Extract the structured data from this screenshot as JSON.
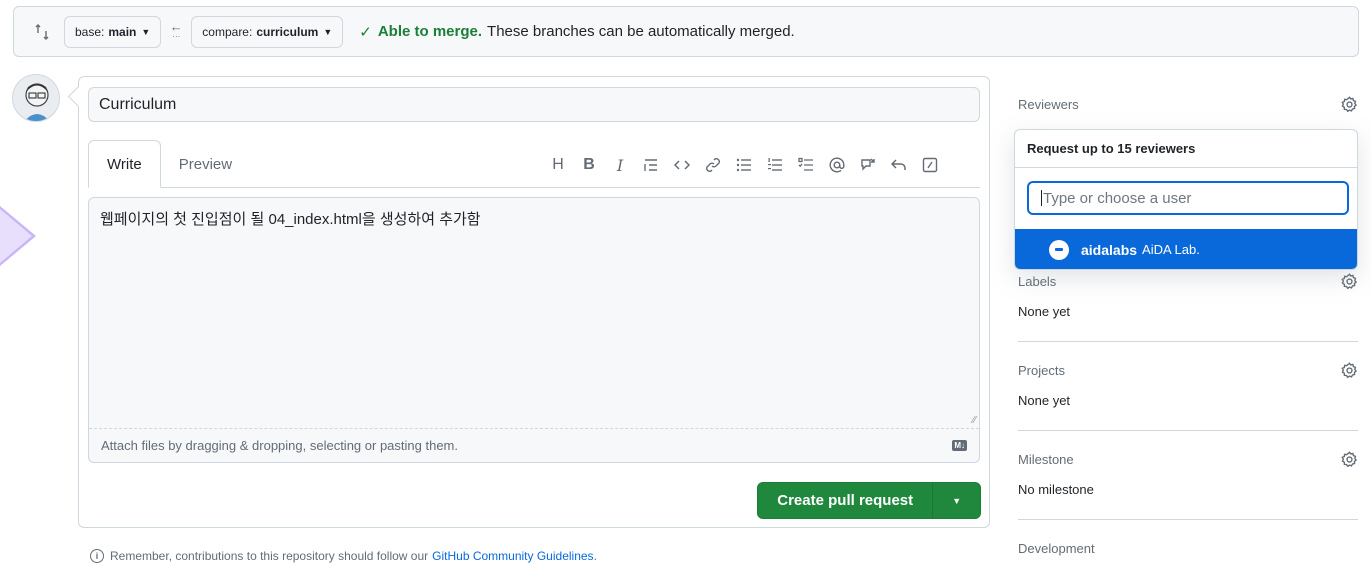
{
  "compare": {
    "base_label": "base:",
    "base_branch": "main",
    "compare_label": "compare:",
    "compare_branch": "curriculum",
    "merge_ok": "Able to merge.",
    "merge_text": "These branches can be automatically merged."
  },
  "form": {
    "title_value": "Curriculum",
    "tabs": [
      {
        "label": "Write",
        "active": true
      },
      {
        "label": "Preview",
        "active": false
      }
    ],
    "toolbar": [
      "heading-icon",
      "bold-icon",
      "italic-icon",
      "quote-icon",
      "code-icon",
      "link-icon",
      "unordered-list-icon",
      "ordered-list-icon",
      "task-list-icon",
      "mention-icon",
      "reference-icon",
      "undo-icon",
      "slash-command-icon"
    ],
    "body_text": "웹페이지의 첫 진입점이 될 04_index.html을 생성하여 추가함",
    "attach_hint": "Attach files by dragging & dropping, selecting or pasting them.",
    "markdown_badge": "M↓",
    "create_label": "Create pull request"
  },
  "footer": {
    "remember_text": "Remember, contributions to this repository should follow our",
    "guidelines_link": "GitHub Community Guidelines",
    "period": "."
  },
  "sidebar": {
    "reviewers": {
      "label": "Reviewers"
    },
    "labels": {
      "label": "Labels",
      "value": "None yet"
    },
    "projects": {
      "label": "Projects",
      "value": "None yet"
    },
    "milestone": {
      "label": "Milestone",
      "value": "No milestone"
    },
    "development": {
      "label": "Development"
    }
  },
  "reviewer_popover": {
    "header": "Request up to 15 reviewers",
    "input_placeholder": "Type or choose a user",
    "suggestion_login": "aidalabs",
    "suggestion_name": "AiDA Lab."
  },
  "colors": {
    "accent": "#0969da",
    "success": "#1f883d",
    "border": "#d0d7de",
    "muted": "#636c76"
  }
}
